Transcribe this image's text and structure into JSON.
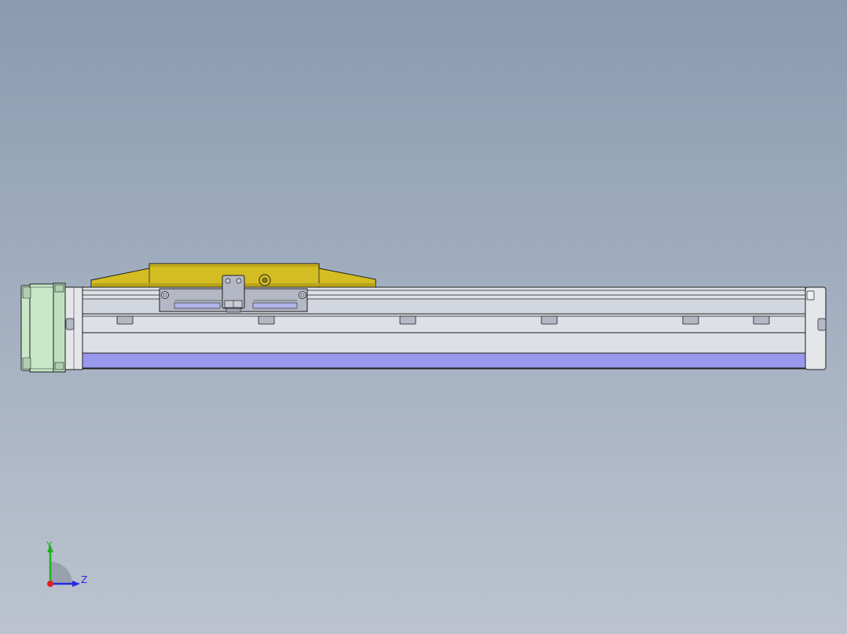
{
  "viewport": {
    "background_top": "#8a9bb0",
    "background_bottom": "#bcc3cf"
  },
  "model": {
    "carriage_color": "#d4bd22",
    "motor_color": "#c8e8c8",
    "rail_color": "#dde0e6",
    "strip_color": "#9898ec",
    "bracket_color": "#b4b8c4",
    "outline_color": "#1e1e1e"
  },
  "triad": {
    "y_label": "Y",
    "z_label": "Z",
    "y_color": "#1db01d",
    "z_color": "#2a2ae0",
    "x_color": "#e02020"
  }
}
